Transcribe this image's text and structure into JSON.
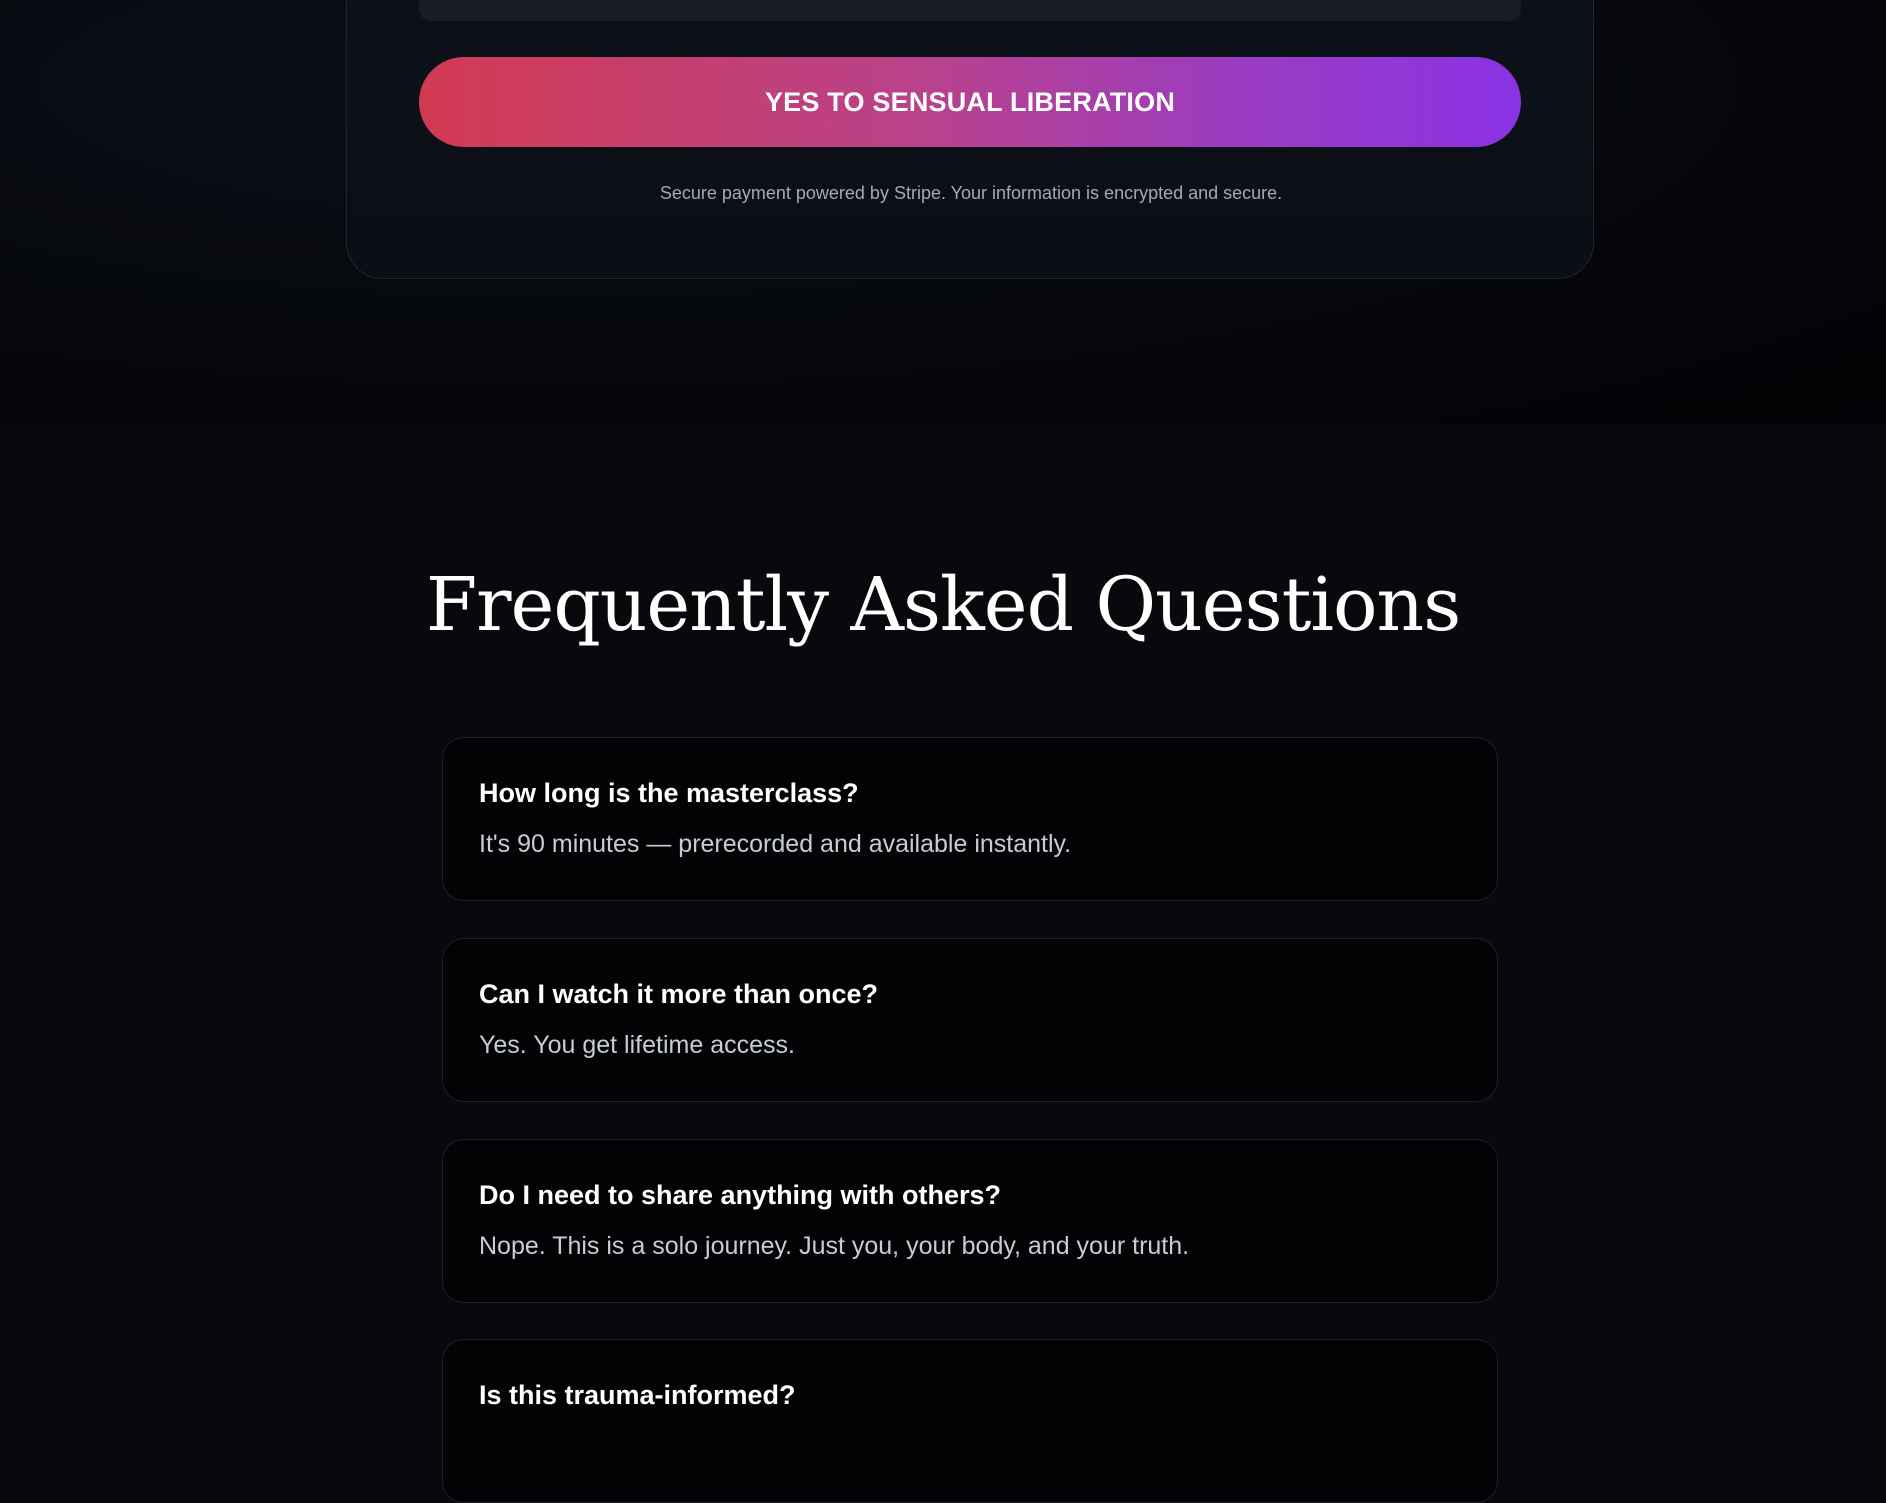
{
  "checkout": {
    "cta_label": "YES TO SENSUAL LIBERATION",
    "secure_note": "Secure payment powered by Stripe. Your information is encrypted and secure."
  },
  "faq": {
    "title": "Frequently Asked Questions",
    "items": [
      {
        "question": "How long is the masterclass?",
        "answer": "It's 90 minutes — prerecorded and available instantly."
      },
      {
        "question": "Can I watch it more than once?",
        "answer": "Yes. You get lifetime access."
      },
      {
        "question": "Do I need to share anything with others?",
        "answer": "Nope. This is a solo journey. Just you, your body, and your truth."
      },
      {
        "question": "Is this trauma-informed?",
        "answer": ""
      }
    ]
  },
  "colors": {
    "background": "#07090d",
    "cta_gradient_start": "#d23a52",
    "cta_gradient_end": "#8a33e6",
    "card_border": "#1c2029"
  }
}
